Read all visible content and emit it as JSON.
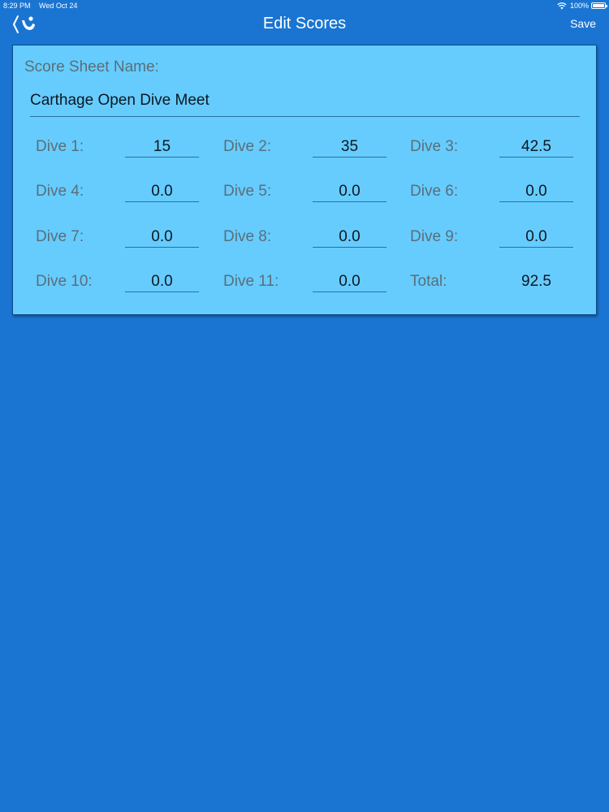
{
  "status_bar": {
    "time": "8:29 PM",
    "date": "Wed Oct 24",
    "battery": "100%"
  },
  "nav": {
    "title": "Edit Scores",
    "save_label": "Save"
  },
  "sheet": {
    "name_label": "Score Sheet Name:",
    "name_value": "Carthage Open Dive Meet"
  },
  "dives": [
    {
      "label": "Dive 1:",
      "value": "15"
    },
    {
      "label": "Dive 2:",
      "value": "35"
    },
    {
      "label": "Dive 3:",
      "value": "42.5"
    },
    {
      "label": "Dive 4:",
      "value": "0.0"
    },
    {
      "label": "Dive 5:",
      "value": "0.0"
    },
    {
      "label": "Dive 6:",
      "value": "0.0"
    },
    {
      "label": "Dive 7:",
      "value": "0.0"
    },
    {
      "label": "Dive 8:",
      "value": "0.0"
    },
    {
      "label": "Dive 9:",
      "value": "0.0"
    },
    {
      "label": "Dive 10:",
      "value": "0.0"
    },
    {
      "label": "Dive 11:",
      "value": "0.0"
    }
  ],
  "total": {
    "label": "Total:",
    "value": "92.5"
  },
  "icons": {
    "back": "back-diver-icon",
    "wifi": "wifi-icon",
    "battery": "battery-icon"
  },
  "colors": {
    "background": "#1a75d2",
    "card": "#66ccfe",
    "text_primary": "#0c1822",
    "text_label": "#5a6e7a"
  }
}
